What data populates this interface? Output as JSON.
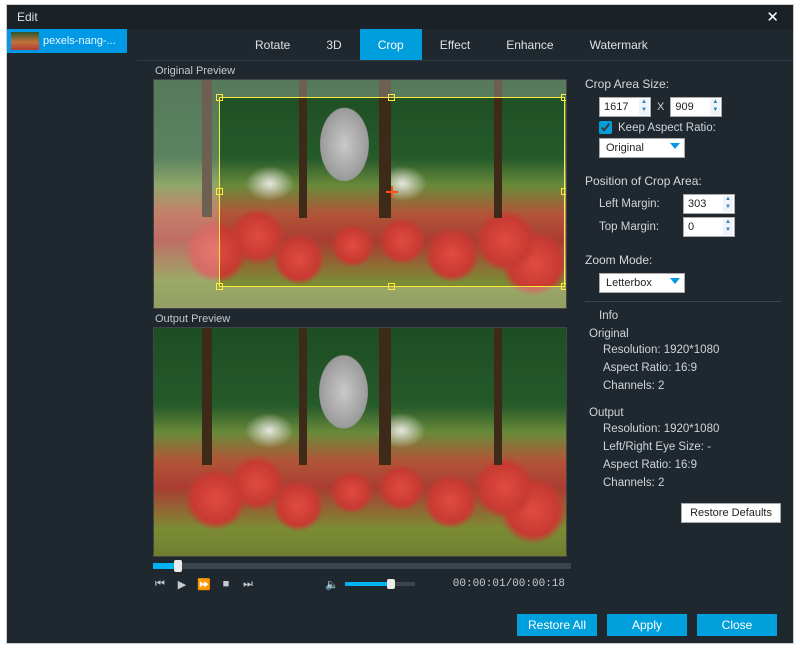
{
  "window": {
    "title": "Edit"
  },
  "file": {
    "name": "pexels-nang-..."
  },
  "tabs": {
    "rotate": "Rotate",
    "threeD": "3D",
    "crop": "Crop",
    "effect": "Effect",
    "enhance": "Enhance",
    "watermark": "Watermark",
    "active": "crop"
  },
  "preview": {
    "original_label": "Original Preview",
    "output_label": "Output Preview"
  },
  "playback": {
    "time": "00:00:01/00:00:18"
  },
  "crop": {
    "section_label": "Crop Area Size:",
    "width": "1617",
    "height": "909",
    "separator": "X",
    "keep_ratio_label": "Keep Aspect Ratio:",
    "keep_ratio_checked": true,
    "ratio_preset": "Original"
  },
  "position": {
    "section_label": "Position of Crop Area:",
    "left_label": "Left Margin:",
    "left_value": "303",
    "top_label": "Top Margin:",
    "top_value": "0"
  },
  "zoom": {
    "section_label": "Zoom Mode:",
    "value": "Letterbox"
  },
  "info": {
    "section_label": "Info",
    "original": {
      "hd": "Original",
      "resolution": "Resolution: 1920*1080",
      "aspect": "Aspect Ratio: 16:9",
      "channels": "Channels: 2"
    },
    "output": {
      "hd": "Output",
      "resolution": "Resolution: 1920*1080",
      "eye": "Left/Right Eye Size: -",
      "aspect": "Aspect Ratio: 16:9",
      "channels": "Channels: 2"
    }
  },
  "buttons": {
    "restore_defaults": "Restore Defaults",
    "restore_all": "Restore All",
    "apply": "Apply",
    "close": "Close"
  }
}
